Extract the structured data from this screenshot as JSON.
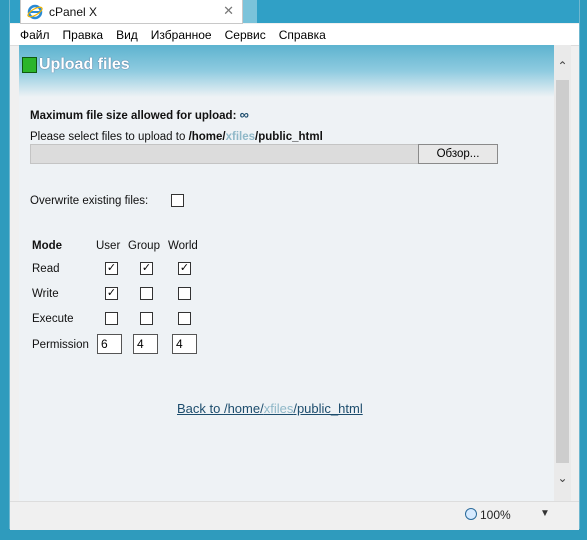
{
  "tab": {
    "title": "cPanel X",
    "close": "✕"
  },
  "menu": [
    "Файл",
    "Правка",
    "Вид",
    "Избранное",
    "Сервис",
    "Справка"
  ],
  "page": {
    "title": "Upload files",
    "max_label": "Maximum file size allowed for upload:",
    "max_value": "∞",
    "select_prefix": "Please select files to upload to",
    "path_part1": "/home/",
    "path_user": "xfiles",
    "path_part2": "/public_html",
    "browse": "Обзор...",
    "overwrite": "Overwrite existing files:",
    "headers": {
      "mode": "Mode",
      "user": "User",
      "group": "Group",
      "world": "World"
    },
    "rows": [
      {
        "label": "Read",
        "user": true,
        "group": true,
        "world": true
      },
      {
        "label": "Write",
        "user": true,
        "group": false,
        "world": false
      },
      {
        "label": "Execute",
        "user": false,
        "group": false,
        "world": false
      }
    ],
    "permission_label": "Permission",
    "permission": {
      "user": "6",
      "group": "4",
      "world": "4"
    },
    "back_prefix": "Back to /home/",
    "back_user": "xfiles",
    "back_suffix": "/public_html"
  },
  "status": {
    "zoom": "100%"
  },
  "check_glyph": "✓"
}
